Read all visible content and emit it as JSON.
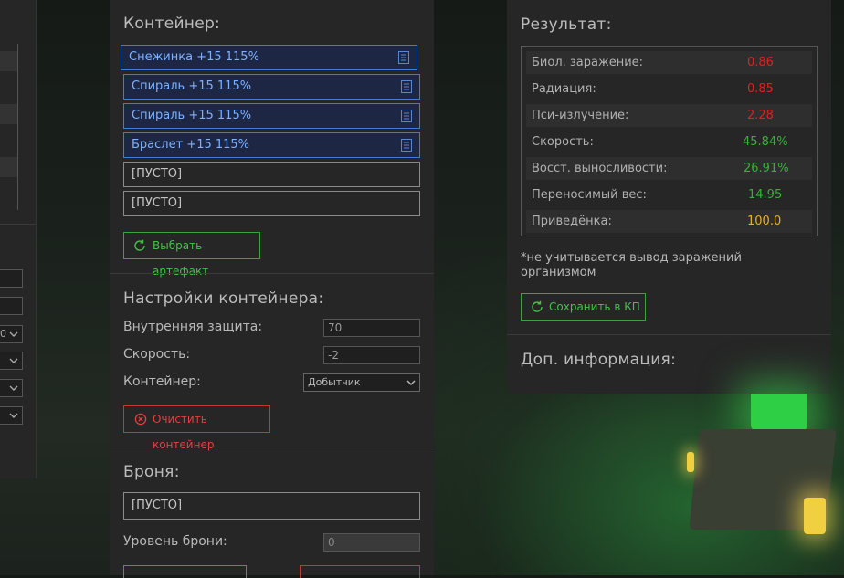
{
  "left_panel": {
    "partial_select_value": "0"
  },
  "container_section": {
    "heading": "Контейнер:",
    "slots": [
      {
        "label": "Снежинка +15 115%",
        "filled": true
      },
      {
        "label": "Спираль +15 115%",
        "filled": true
      },
      {
        "label": "Спираль +15 115%",
        "filled": true
      },
      {
        "label": "Браслет +15 115%",
        "filled": true
      },
      {
        "label": "[ПУСТО]",
        "filled": false
      },
      {
        "label": "[ПУСТО]",
        "filled": false
      }
    ],
    "choose_artifact_button": "Выбрать артефакт"
  },
  "container_settings": {
    "heading": "Настройки контейнера:",
    "inner_protection_label": "Внутренняя защита:",
    "inner_protection_value": "70",
    "speed_label": "Скорость:",
    "speed_value": "-2",
    "container_label": "Контейнер:",
    "container_value": "Добытчик",
    "clear_button": "Очистить контейнер"
  },
  "armor_section": {
    "heading": "Броня:",
    "slot_label": "[ПУСТО]",
    "level_label": "Уровень брони:",
    "level_value": "0"
  },
  "result_section": {
    "heading": "Результат:",
    "rows": [
      {
        "name": "Биол. заражение:",
        "value": "0.86",
        "color": "#e02020"
      },
      {
        "name": "Радиация:",
        "value": "0.85",
        "color": "#e02020"
      },
      {
        "name": "Пси-излучение:",
        "value": "2.28",
        "color": "#e02020"
      },
      {
        "name": "Скорость:",
        "value": "45.84%",
        "color": "#32b432"
      },
      {
        "name": "Восст. выносливости:",
        "value": "26.91%",
        "color": "#32b432"
      },
      {
        "name": "Переносимый вес:",
        "value": "14.95",
        "color": "#32b432"
      },
      {
        "name": "Приведёнка:",
        "value": "100.0",
        "color": "#e8b020"
      }
    ],
    "note": "*не учитывается вывод заражений организмом",
    "save_button": "Сохранить в КП"
  },
  "extra_info": {
    "heading": "Доп. информация:"
  },
  "colors": {
    "accent_blue": "#3f7ad6",
    "accent_green": "#36a43a",
    "accent_red": "#cc3333"
  }
}
